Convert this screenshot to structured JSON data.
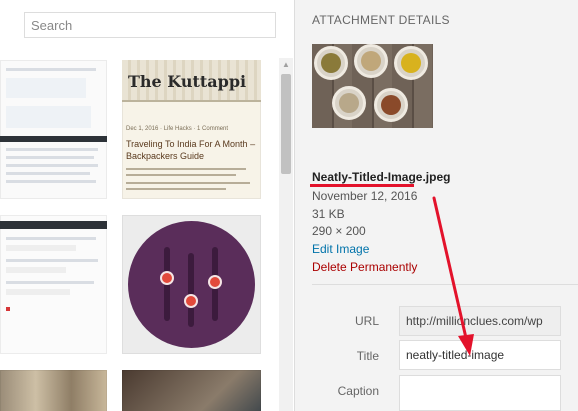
{
  "library": {
    "search": {
      "placeholder": "Search",
      "value": ""
    },
    "thumbnails": [
      {
        "name": "dashboard-screenshot"
      },
      {
        "name": "blog-post-screenshot",
        "banner_title": "The Kuttappi",
        "meta": "Dec 1, 2016 · Life Hacks · 1 Comment",
        "title": "Traveling To India For A Month – Backpackers Guide"
      },
      {
        "name": "login-settings-screenshot"
      },
      {
        "name": "equalizer-icon"
      },
      {
        "name": "photo-thumbnail"
      },
      {
        "name": "photo-thumbnail"
      }
    ]
  },
  "details": {
    "heading": "ATTACHMENT DETAILS",
    "filename": "Neatly-Titled-Image.jpeg",
    "date": "November 12, 2016",
    "size": "31 KB",
    "dimensions": "290 × 200",
    "edit_link": "Edit Image",
    "delete_link": "Delete Permanently",
    "fields": {
      "url_label": "URL",
      "url_value": "http://millionclues.com/wp",
      "title_label": "Title",
      "title_value": "neatly-titled-image",
      "caption_label": "Caption",
      "caption_value": ""
    }
  },
  "colors": {
    "annotation": "#e3122b",
    "link": "#0073aa",
    "danger": "#aa0000",
    "equalizer_bg": "#5a2d5a",
    "equalizer_knob": "#e24a3b"
  }
}
